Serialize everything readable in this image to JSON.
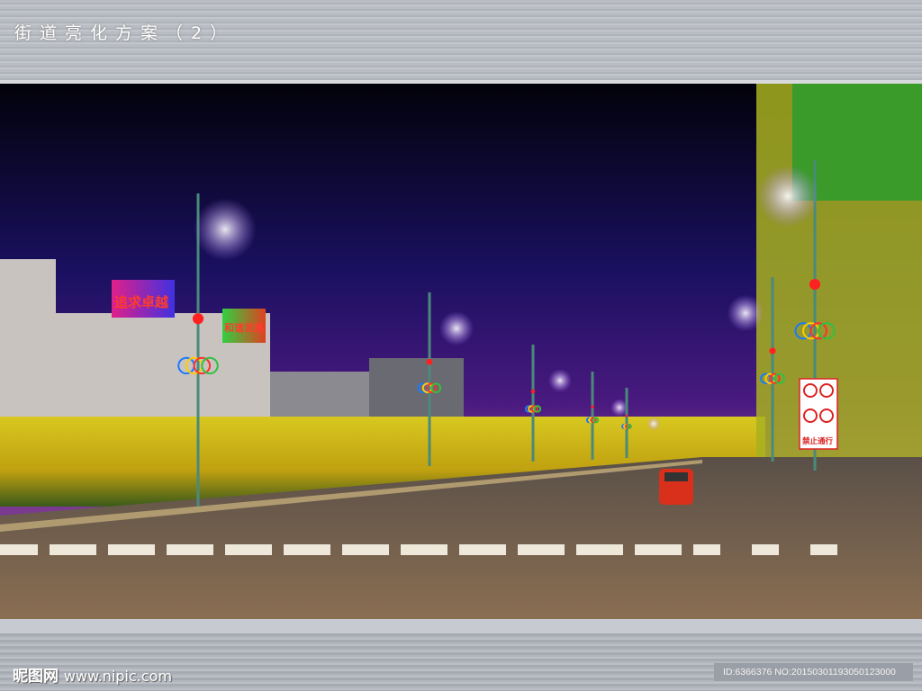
{
  "header": {
    "title": "街道亮化方案（2）"
  },
  "scene": {
    "billboards": [
      "追求卓越",
      "和谐发展"
    ],
    "traffic_sign": {
      "text": "禁止通行"
    }
  },
  "footer": {
    "site_name": "昵图网",
    "site_url": "www.nipic.com",
    "image_id": "ID:6366376 NO:20150301193050123000"
  }
}
